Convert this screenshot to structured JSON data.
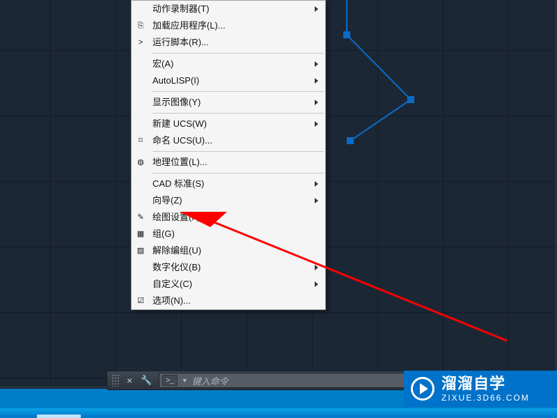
{
  "menu": [
    {
      "label": "动作录制器(T)",
      "icon": "",
      "submenu": true
    },
    {
      "label": "加载应用程序(L)...",
      "icon": "⎘"
    },
    {
      "label": "运行脚本(R)...",
      "icon": ">"
    },
    {
      "sep": true
    },
    {
      "label": "宏(A)",
      "submenu": true
    },
    {
      "label": "AutoLISP(I)",
      "submenu": true
    },
    {
      "sep": true
    },
    {
      "label": "显示图像(Y)",
      "submenu": true
    },
    {
      "sep": true
    },
    {
      "label": "新建 UCS(W)",
      "submenu": true
    },
    {
      "label": "命名 UCS(U)...",
      "icon": "⌑"
    },
    {
      "sep": true
    },
    {
      "label": "地理位置(L)...",
      "icon": "◍"
    },
    {
      "sep": true
    },
    {
      "label": "CAD 标准(S)",
      "submenu": true
    },
    {
      "label": "向导(Z)",
      "submenu": true
    },
    {
      "label": "绘图设置(F)...",
      "icon": "✎"
    },
    {
      "label": "组(G)",
      "icon": "▦"
    },
    {
      "label": "解除编组(U)",
      "icon": "▨"
    },
    {
      "label": "数字化仪(B)",
      "submenu": true
    },
    {
      "label": "自定义(C)",
      "submenu": true
    },
    {
      "label": "选项(N)...",
      "icon": "☑"
    }
  ],
  "command": {
    "placeholder": "键入命令"
  },
  "badge": {
    "main": "溜溜自学",
    "sub": "ZIXUE.3D66.COM"
  }
}
